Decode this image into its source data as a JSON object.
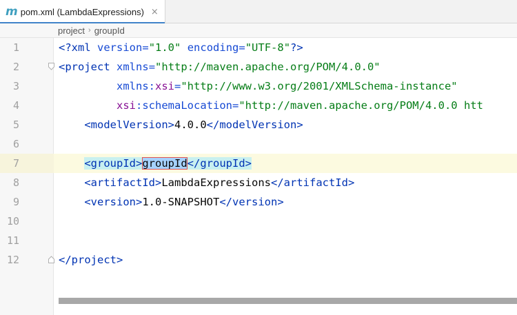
{
  "tab": {
    "icon_glyph": "m",
    "title": "pom.xml (LambdaExpressions)",
    "close_glyph": "×"
  },
  "breadcrumb": {
    "items": [
      "project",
      "groupId"
    ],
    "separator": "›"
  },
  "editor": {
    "current_line": 7,
    "line_numbers": [
      "1",
      "2",
      "3",
      "4",
      "5",
      "6",
      "7",
      "8",
      "9",
      "10",
      "11",
      "12"
    ],
    "line1": {
      "lt": "<?",
      "xml": "xml",
      "version_attr": "version",
      "eq": "=",
      "version_val": "\"1.0\"",
      "encoding_attr": "encoding",
      "encoding_val": "\"UTF-8\"",
      "end": "?>"
    },
    "line2": {
      "open": "<",
      "tag": "project",
      "attr": "xmlns",
      "eq": "=",
      "val": "\"http://maven.apache.org/POM/4.0.0\""
    },
    "line3": {
      "attr_prefix": "xmlns:",
      "attr_ns": "xsi",
      "eq": "=",
      "val": "\"http://www.w3.org/2001/XMLSchema-instance\""
    },
    "line4": {
      "attr_ns": "xsi",
      "attr_suffix": ":schemaLocation",
      "eq": "=",
      "val": "\"http://maven.apache.org/POM/4.0.0 htt"
    },
    "line5": {
      "open": "<",
      "tag": "modelVersion",
      "close": ">",
      "text": "4.0.0",
      "end_open": "</",
      "end_tag": "modelVersion",
      "end_close": ">"
    },
    "line7": {
      "open": "<",
      "tag": "groupId",
      "close": ">",
      "text": "groupId",
      "end_open": "</",
      "end_tag": "groupId",
      "end_close": ">"
    },
    "line8": {
      "open": "<",
      "tag": "artifactId",
      "close": ">",
      "text": "LambdaExpressions",
      "end_open": "</",
      "end_tag": "artifactId",
      "end_close": ">"
    },
    "line9": {
      "open": "<",
      "tag": "version",
      "close": ">",
      "text": "1.0-SNAPSHOT",
      "end_open": "</",
      "end_tag": "version",
      "end_close": ">"
    },
    "line12": {
      "open": "</",
      "tag": "project",
      "close": ">"
    }
  },
  "colors": {
    "tag": "#0033b3",
    "attribute": "#174ad4",
    "value": "#067d17",
    "namespace": "#871094",
    "current_line_bg": "#fcfae0",
    "selection": "#a6d2ff",
    "tab_accent": "#4083c9"
  }
}
